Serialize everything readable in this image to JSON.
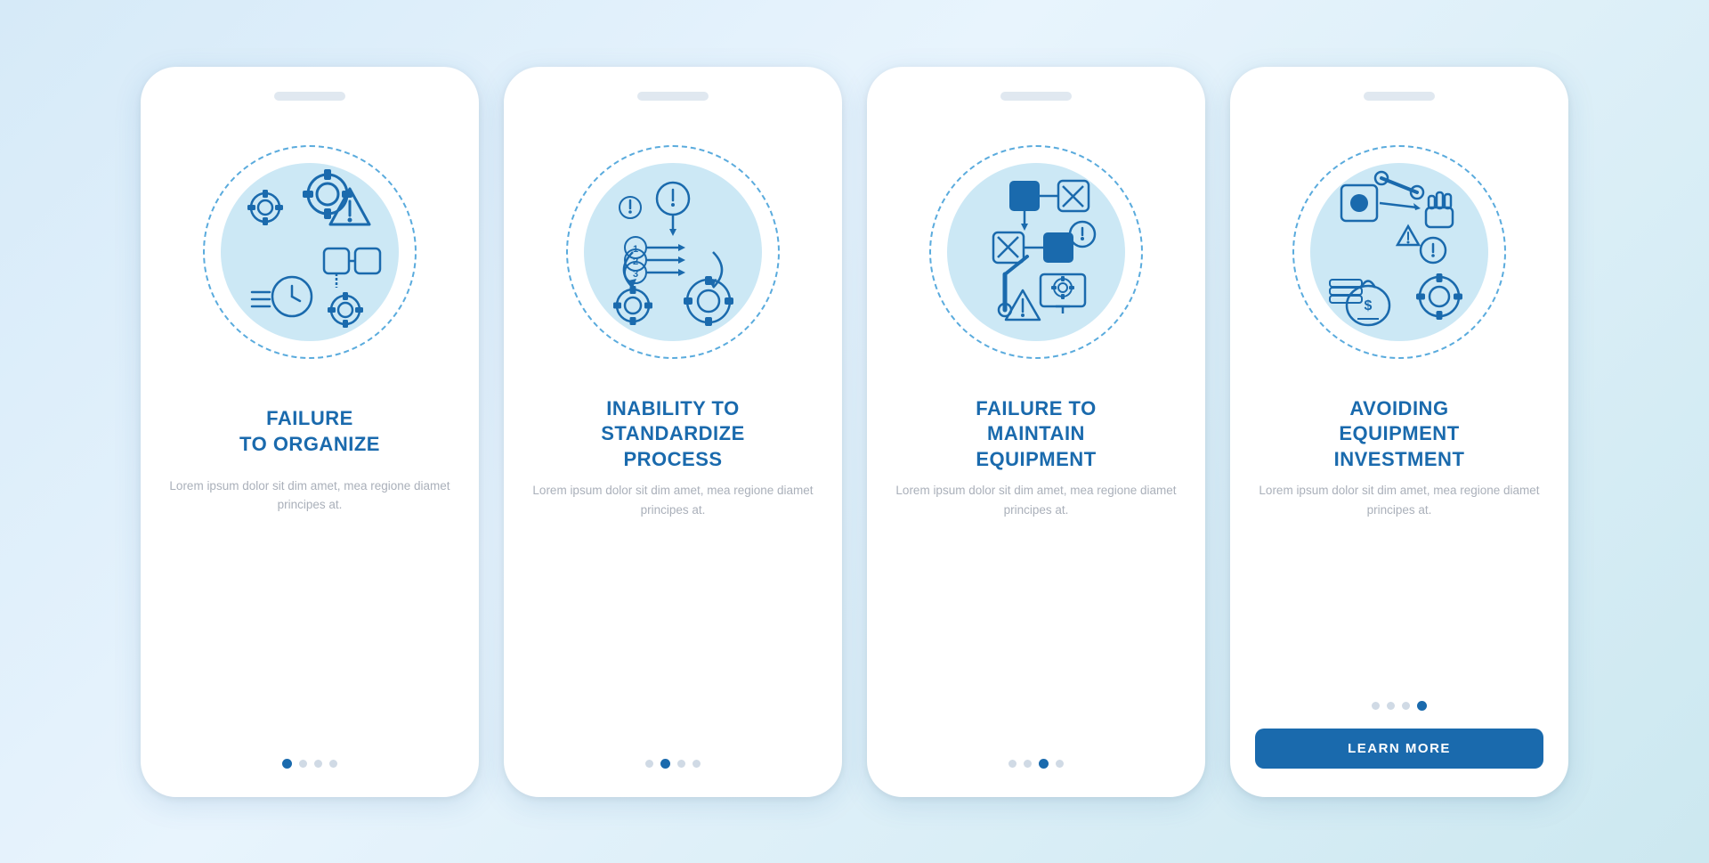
{
  "background": {
    "gradient_start": "#d6eaf8",
    "gradient_end": "#cce8f0"
  },
  "cards": [
    {
      "id": "card-1",
      "title": "FAILURE\nTO ORGANIZE",
      "body_text": "Lorem ipsum dolor sit dim amet, mea regione diamet principes at.",
      "dots": [
        true,
        false,
        false,
        false
      ],
      "show_button": false,
      "button_label": ""
    },
    {
      "id": "card-2",
      "title": "INABILITY TO\nSTANDARDIZE\nPROCESS",
      "body_text": "Lorem ipsum dolor sit dim amet, mea regione diamet principes at.",
      "dots": [
        false,
        true,
        false,
        false
      ],
      "show_button": false,
      "button_label": ""
    },
    {
      "id": "card-3",
      "title": "FAILURE TO\nMAINTAIN\nEQUIPMENT",
      "body_text": "Lorem ipsum dolor sit dim amet, mea regione diamet principes at.",
      "dots": [
        false,
        false,
        true,
        false
      ],
      "show_button": false,
      "button_label": ""
    },
    {
      "id": "card-4",
      "title": "AVOIDING\nEQUIPMENT\nINVESTMENT",
      "body_text": "Lorem ipsum dolor sit dim amet, mea regione diamet principes at.",
      "dots": [
        false,
        false,
        false,
        true
      ],
      "show_button": true,
      "button_label": "LEARN MORE"
    }
  ]
}
